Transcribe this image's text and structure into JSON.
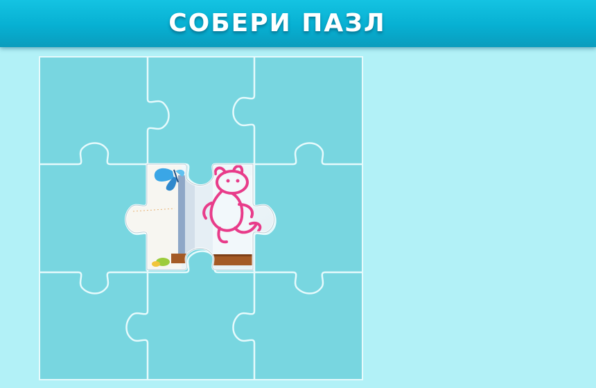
{
  "header": {
    "title": "СОБЕРИ ПАЗЛ"
  },
  "board": {
    "rows": 3,
    "columns": 3,
    "placed_piece_name": "center-piece"
  },
  "colors": {
    "background": "#b2f1f7",
    "header": "#07b0d2",
    "board": "#78d6e0",
    "board_lines": "#e6fafc",
    "drawing_pink": "#e83c8a",
    "butterfly_blue": "#3aa6e6",
    "wood_brown": "#a45a25"
  }
}
